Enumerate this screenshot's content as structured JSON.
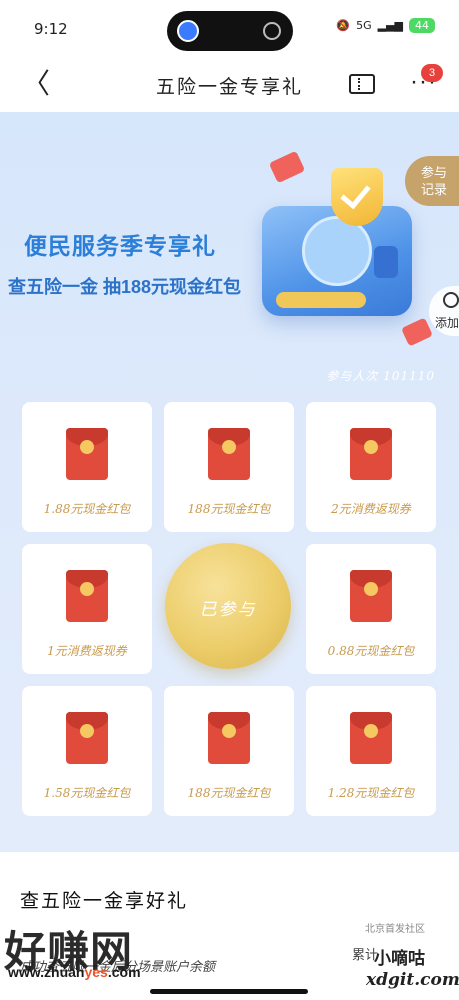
{
  "status_bar": {
    "time": "9:12",
    "signal_text": "5G",
    "battery": "44"
  },
  "nav": {
    "back_glyph": "〈",
    "title": "五险一金专享礼",
    "more_glyph": "···",
    "badge_count": "3"
  },
  "side_buttons": {
    "record_line1": "参与",
    "record_line2": "记录",
    "add_label": "添加"
  },
  "hero": {
    "title": "便民服务季专享礼",
    "subtitle": "查五险一金 抽188元现金红包",
    "participants": "参与人次 101110"
  },
  "prizes": [
    {
      "label": "1.88元现金红包"
    },
    {
      "label": "188元现金红包"
    },
    {
      "label": "2元消费返现券"
    },
    {
      "label": "1元消费返现券"
    },
    {
      "label": "0.88元现金红包"
    },
    {
      "label": "1.58元现金红包"
    },
    {
      "label": "188元现金红包"
    },
    {
      "label": "1.28元现金红包"
    }
  ],
  "center_button": "已参与",
  "bottom": {
    "heading": "查五险一金享好礼",
    "description": "成功查五险一金后分场景账户余额",
    "cumulative": "累计"
  },
  "watermark": {
    "logo": "好赚网",
    "url_prefix": "www.zhuan",
    "url_accent": "yes",
    "url_suffix": ".com",
    "small": "北京首发社区",
    "brand": "小嘀咕",
    "site": "xdgit.com"
  },
  "colors": {
    "accent_blue": "#2b7fd8",
    "gold": "#c99a4c",
    "red_envelope": "#e04b3b",
    "badge_red": "#e8413c"
  }
}
